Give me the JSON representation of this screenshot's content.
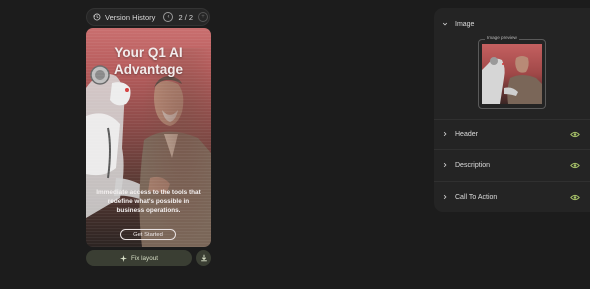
{
  "version_history": {
    "label": "Version History",
    "counter": "2 / 2",
    "prev_symbol": "‹",
    "next_symbol": "+"
  },
  "preview_card": {
    "headline": "Your Q1 AI Advantage",
    "description": "Immediate access to the tools that redefine what's possible in business operations.",
    "cta_label": "Get Started"
  },
  "actions": {
    "fix_layout_label": "Fix layout"
  },
  "panel": {
    "image": {
      "title": "Image",
      "preview_label": "Image preview"
    },
    "sections": [
      {
        "label": "Header",
        "visible": true
      },
      {
        "label": "Description",
        "visible": true
      },
      {
        "label": "Call To Action",
        "visible": true
      }
    ]
  },
  "colors": {
    "background": "#1c1c1c",
    "panel": "#242424",
    "eye_icon": "#a9c46a",
    "fix_button": "#3a3e33"
  }
}
